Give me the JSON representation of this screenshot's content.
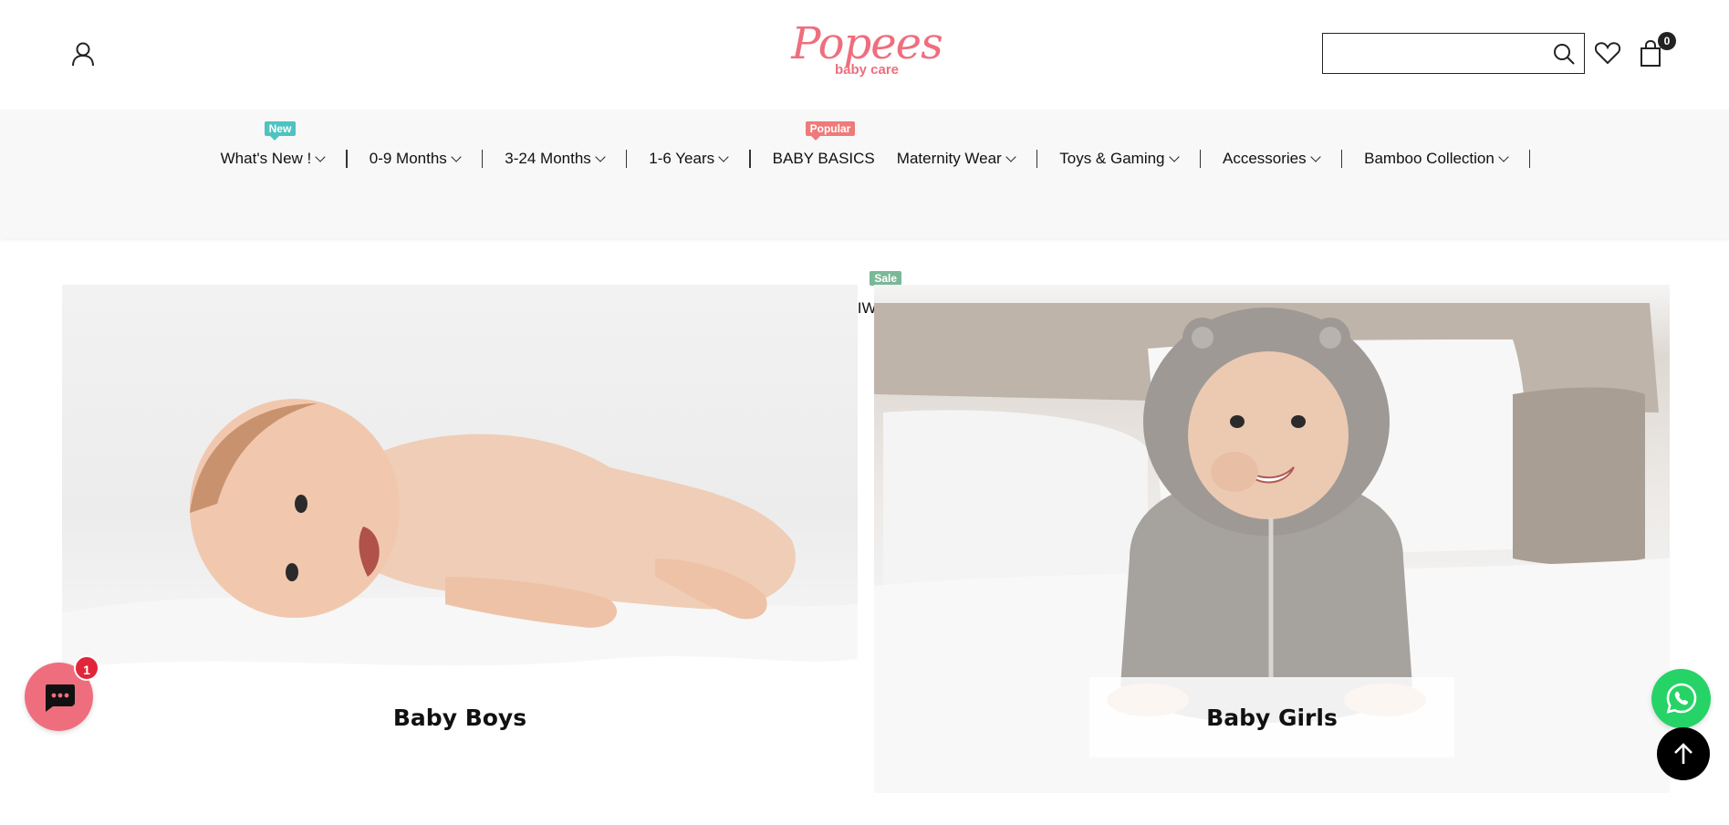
{
  "header": {
    "logo_text": "Popees",
    "logo_subtext": "baby care",
    "search_placeholder": "",
    "cart_count": "0"
  },
  "nav": {
    "items": [
      {
        "label": "What's New !",
        "dropdown": true,
        "tag": "New"
      },
      {
        "label": "0-9 Months",
        "dropdown": true
      },
      {
        "label": "3-24 Months",
        "dropdown": true
      },
      {
        "label": "1-6 Years",
        "dropdown": true
      },
      {
        "label": "BABY BASICS",
        "dropdown": false,
        "tag": "Popular"
      },
      {
        "label": "Maternity Wear",
        "dropdown": true
      },
      {
        "label": "Toys & Gaming",
        "dropdown": true
      },
      {
        "label": "Accessories",
        "dropdown": true
      },
      {
        "label": "Bamboo Collection",
        "dropdown": true
      }
    ],
    "row2": {
      "label": "GRAND DIWALI SALE",
      "tag": "Sale"
    }
  },
  "banners": [
    {
      "label": "Baby Boys"
    },
    {
      "label": "Baby Girls"
    }
  ],
  "widgets": {
    "chat_badge": "1"
  },
  "colors": {
    "brand": "#ef6e7e",
    "tag_new": "#4fc3c0",
    "tag_popular": "#ef7a7a",
    "tag_sale": "#7ab898",
    "whatsapp": "#25d366"
  }
}
